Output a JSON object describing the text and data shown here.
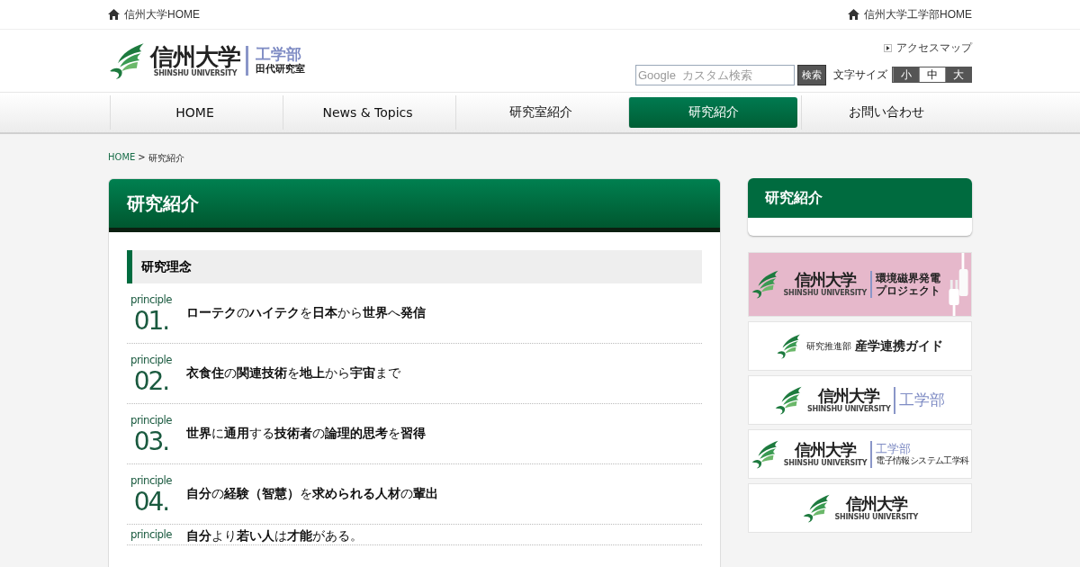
{
  "top_bar": {
    "left_link": "信州大学HOME",
    "right_link": "信州大学工学部HOME"
  },
  "header": {
    "logo": {
      "name": "信州大学",
      "roman": "SHINSHU UNIVERSITY",
      "dept": "工学部",
      "lab": "田代研究室"
    },
    "access_link": "アクセスマップ",
    "search": {
      "placeholder": "Google  カスタム検索",
      "button": "検索"
    },
    "font_size": {
      "label": "文字サイズ",
      "options": [
        {
          "label": "小",
          "selected": false
        },
        {
          "label": "中",
          "selected": true
        },
        {
          "label": "大",
          "selected": false
        }
      ]
    }
  },
  "nav": [
    {
      "label": "HOME",
      "selected": false
    },
    {
      "label": "News & Topics",
      "selected": false
    },
    {
      "label": "研究室紹介",
      "selected": false
    },
    {
      "label": "研究紹介",
      "selected": true
    },
    {
      "label": "お問い合わせ",
      "selected": false
    }
  ],
  "breadcrumb": {
    "link": "HOME",
    "separator": ">",
    "current": "研究紹介"
  },
  "main": {
    "title": "研究紹介",
    "section_heading": "研究理念",
    "principles": [
      {
        "label": "principle",
        "number": "01.",
        "text": "**ローテク**の**ハイテク**を**日本**から**世界**へ**発信**"
      },
      {
        "label": "principle",
        "number": "02.",
        "text": "**衣食住**の**関連技術**を**地上**から**宇宙**まで"
      },
      {
        "label": "principle",
        "number": "03.",
        "text": "**世界**に**通用**する**技術者**の**論理的思考**を**習得**"
      },
      {
        "label": "principle",
        "number": "04.",
        "text": "**自分**の**経験（智慧）**を**求められる人材**の**輩出**"
      },
      {
        "label": "principle",
        "text": "**自分**より**若い人**は**才能**がある。"
      }
    ]
  },
  "sidebar": {
    "title": "研究紹介",
    "banners": [
      {
        "kind": "project",
        "name": "信州大学",
        "roman": "SHINSHU UNIVERSITY",
        "lines": [
          "環境磁界発電",
          "プロジェクト"
        ]
      },
      {
        "kind": "guide",
        "org": "研究推進部",
        "title": "産学連携ガイド"
      },
      {
        "kind": "logo",
        "name": "信州大学",
        "roman": "SHINSHU UNIVERSITY",
        "dept": "工学部"
      },
      {
        "kind": "logo",
        "name": "信州大学",
        "roman": "SHINSHU UNIVERSITY",
        "dept": "工学部",
        "sub": "電子情報システム工学科"
      },
      {
        "kind": "logo",
        "name": "信州大学",
        "roman": "SHINSHU UNIVERSITY"
      }
    ]
  }
}
